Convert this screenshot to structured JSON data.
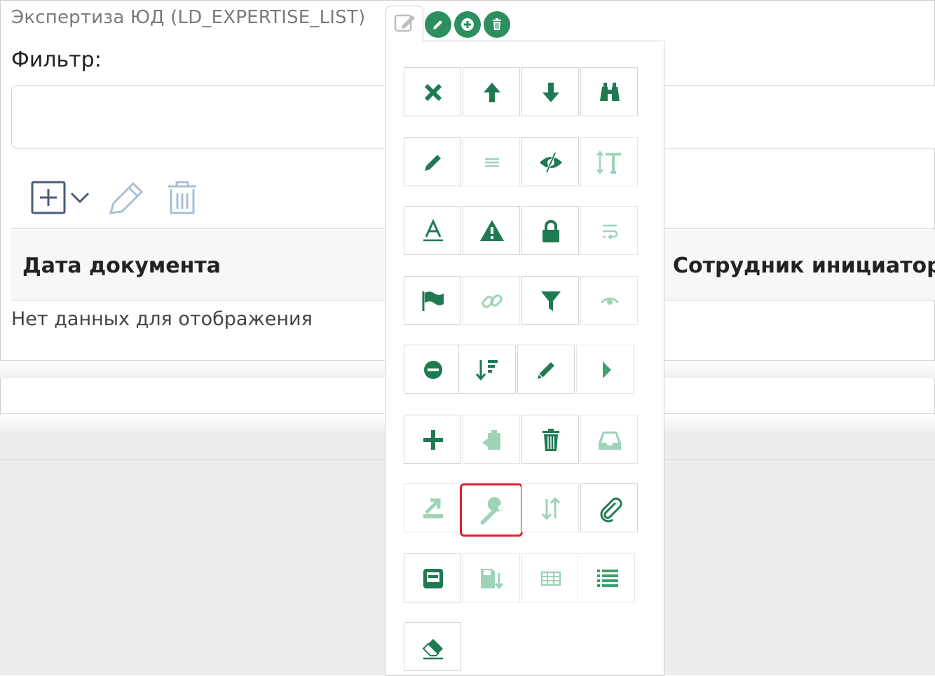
{
  "window": {
    "title": "Экспертиза ЮД (LD_EXPERTISE_LIST)"
  },
  "filter": {
    "label": "Фильтр:",
    "value": "",
    "placeholder": ""
  },
  "table": {
    "columns": [
      "Дата документа",
      "Сотрудник инициатор"
    ],
    "empty_text": "Нет данных для отображения"
  },
  "colors": {
    "accent": "#2c8f5f",
    "accent_muted": "#9fd3b8",
    "selection_outline": "#e0202e",
    "toolbar_icon": "#4a5d78",
    "toolbar_icon_muted": "#a9bfd4"
  },
  "header_actions": [
    "edit-icon",
    "add-icon",
    "delete-icon"
  ],
  "toolbar": [
    "add-with-dropdown-icon",
    "pencil-icon",
    "trash-icon"
  ],
  "icon_picker": {
    "rows": [
      [
        "close-icon",
        "arrow-up-icon",
        "arrow-down-icon",
        "binoculars-icon"
      ],
      [
        "pencil-icon",
        "list-icon",
        "eye-slash-icon",
        "text-height-icon"
      ],
      [
        "font-icon",
        "warning-icon",
        "lock-icon",
        "text-wrap-icon"
      ],
      [
        "flag-icon",
        "link-icon",
        "filter-icon",
        "eye-icon"
      ],
      [
        "minus-circle-icon",
        "sort-amount-down-icon",
        "pen-icon",
        "caret-right-icon"
      ],
      [
        "plus-icon",
        "paste-icon",
        "trash-icon",
        "inbox-icon"
      ],
      [
        "export-icon",
        "wrench-icon",
        "sort-icon",
        "paperclip-icon"
      ],
      [
        "window-icon",
        "save-arrow-icon",
        "table-icon",
        "list-ul-icon"
      ],
      [
        "eraser-icon"
      ]
    ],
    "selected": "wrench-icon"
  }
}
